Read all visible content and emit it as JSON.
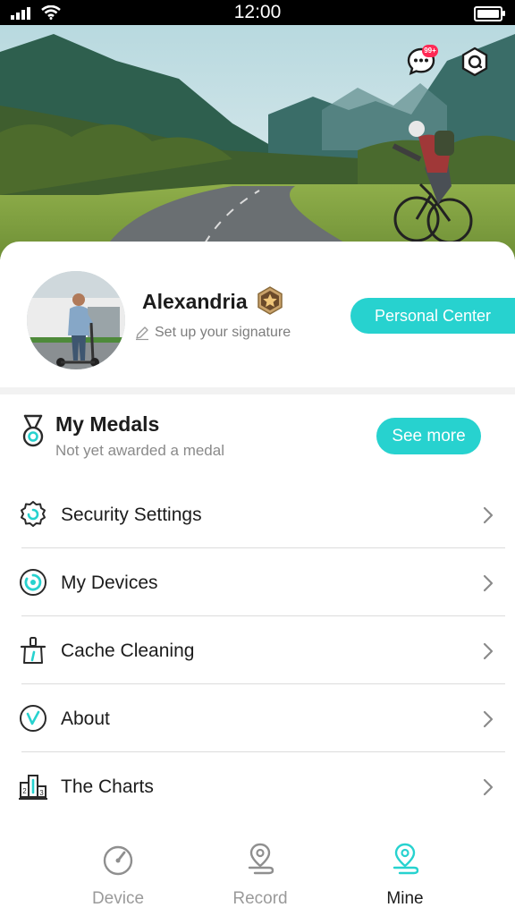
{
  "status_bar": {
    "time": "12:00"
  },
  "header": {
    "notification_badge": "99+"
  },
  "profile": {
    "username": "Alexandria",
    "signature_placeholder": "Set up your signature",
    "personal_center_label": "Personal Center"
  },
  "medals": {
    "title": "My Medals",
    "subtitle": "Not yet awarded a medal",
    "see_more_label": "See more"
  },
  "menu": {
    "items": [
      {
        "label": "Security Settings",
        "icon": "security-settings-icon"
      },
      {
        "label": "My Devices",
        "icon": "my-devices-icon"
      },
      {
        "label": "Cache Cleaning",
        "icon": "cache-cleaning-icon"
      },
      {
        "label": "About",
        "icon": "about-icon"
      },
      {
        "label": "The Charts",
        "icon": "charts-icon"
      }
    ]
  },
  "bottom_nav": {
    "tabs": [
      {
        "label": "Device",
        "icon": "speedometer-icon",
        "active": false
      },
      {
        "label": "Record",
        "icon": "route-pin-icon",
        "active": false
      },
      {
        "label": "Mine",
        "icon": "route-pin-icon",
        "active": true
      }
    ]
  },
  "colors": {
    "accent": "#27d2cf",
    "text_primary": "#1c1c1c",
    "text_secondary": "#8a8a8a",
    "inactive_tab": "#9a9a9a",
    "badge": "#ff2a55"
  }
}
